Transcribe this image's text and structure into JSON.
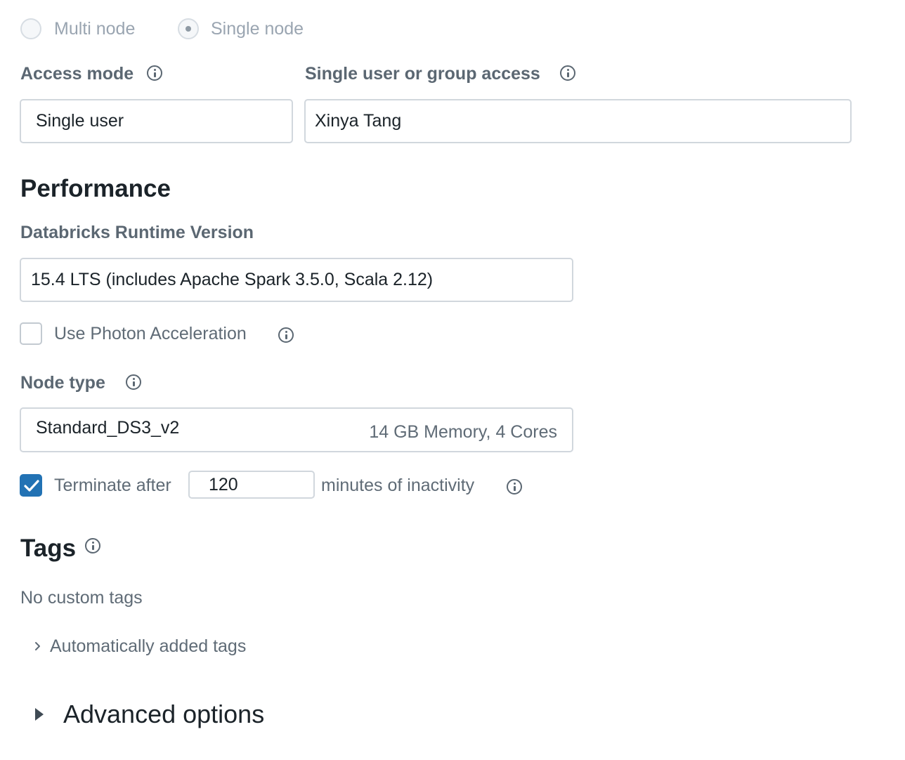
{
  "cluster_type": {
    "multi_node_label": "Multi node",
    "single_node_label": "Single node",
    "selected": "Single node"
  },
  "access": {
    "access_mode_label": "Access mode",
    "access_mode_value": "Single user",
    "user_access_label": "Single user or group access",
    "user_access_value": "Xinya Tang"
  },
  "performance": {
    "title": "Performance",
    "runtime_label": "Databricks Runtime Version",
    "runtime_value": "15.4 LTS (includes Apache Spark 3.5.0, Scala 2.12)",
    "photon_label": "Use Photon Acceleration",
    "photon_checked": false,
    "node_type_label": "Node type",
    "node_type_value": "Standard_DS3_v2",
    "node_type_detail": "14 GB Memory, 4 Cores",
    "terminate_checked": true,
    "terminate_prefix": "Terminate after",
    "terminate_minutes": "120",
    "terminate_suffix": "minutes of inactivity"
  },
  "tags": {
    "title": "Tags",
    "empty_text": "No custom tags",
    "auto_tags_label": "Automatically added tags"
  },
  "advanced": {
    "label": "Advanced options"
  },
  "icons": [
    "info-icon",
    "chevron-right-icon",
    "caret-right-icon",
    "checkmark-icon"
  ],
  "colors": {
    "accent": "#2272b4",
    "label": "#5b6772",
    "border": "#d1d7dd"
  }
}
